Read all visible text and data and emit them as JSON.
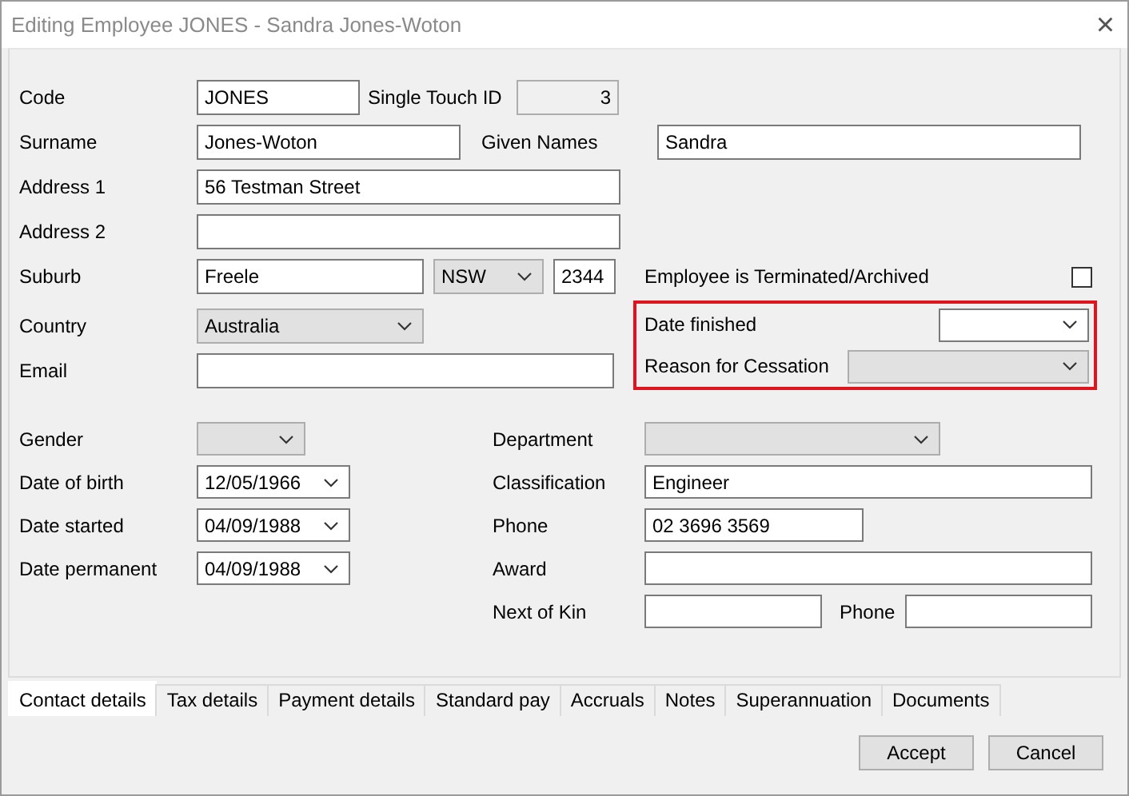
{
  "window": {
    "title": "Editing Employee JONES - Sandra Jones-Woton",
    "close": "×"
  },
  "code": {
    "label": "Code",
    "kind": "text",
    "value": "JONES"
  },
  "single_touch_id": {
    "label": "Single Touch ID",
    "kind": "text",
    "value": "3",
    "disabled": true
  },
  "surname": {
    "label": "Surname",
    "kind": "text",
    "value": "Jones-Woton"
  },
  "given_names": {
    "label": "Given Names",
    "kind": "text",
    "value": "Sandra"
  },
  "address_1": {
    "label": "Address 1",
    "kind": "text",
    "value": "56 Testman Street"
  },
  "address_2": {
    "label": "Address 2",
    "kind": "text"
  },
  "suburb": {
    "label": "Suburb",
    "kind": "text",
    "value": "Freele"
  },
  "state": {
    "kind": "combo",
    "value": "NSW"
  },
  "postcode": {
    "kind": "text",
    "value": "2344"
  },
  "terminated": {
    "label": "Employee is Terminated/Archived",
    "checked": false
  },
  "country": {
    "label": "Country",
    "kind": "combo",
    "value": "Australia"
  },
  "email": {
    "label": "Email",
    "kind": "text"
  },
  "termination": {
    "highlighted": true,
    "date_finished": {
      "label": "Date finished",
      "kind": "date"
    },
    "reason": {
      "label": "Reason for Cessation",
      "kind": "combo"
    }
  },
  "gender": {
    "label": "Gender",
    "kind": "combo"
  },
  "department": {
    "label": "Department",
    "kind": "combo"
  },
  "date_of_birth": {
    "label": "Date of birth",
    "kind": "date",
    "value": "12/05/1966"
  },
  "classification": {
    "label": "Classification",
    "kind": "text",
    "value": "Engineer"
  },
  "date_started": {
    "label": "Date started",
    "kind": "date",
    "value": "04/09/1988"
  },
  "phone": {
    "label": "Phone",
    "kind": "text",
    "value": "02 3696 3569"
  },
  "date_permanent": {
    "label": "Date permanent",
    "kind": "date",
    "value": "04/09/1988"
  },
  "award": {
    "label": "Award",
    "kind": "text"
  },
  "next_of_kin": {
    "label": "Next of Kin",
    "kind": "text"
  },
  "kin_phone": {
    "label": "Phone",
    "kind": "text"
  },
  "tabs": [
    {
      "label": "Contact details",
      "selected": true
    },
    {
      "label": "Tax details",
      "selected": false
    },
    {
      "label": "Payment details",
      "selected": false
    },
    {
      "label": "Standard pay",
      "selected": false
    },
    {
      "label": "Accruals",
      "selected": false
    },
    {
      "label": "Notes",
      "selected": false
    },
    {
      "label": "Superannuation",
      "selected": false
    },
    {
      "label": "Documents",
      "selected": false
    }
  ],
  "buttons": [
    "Accept",
    "Cancel"
  ]
}
